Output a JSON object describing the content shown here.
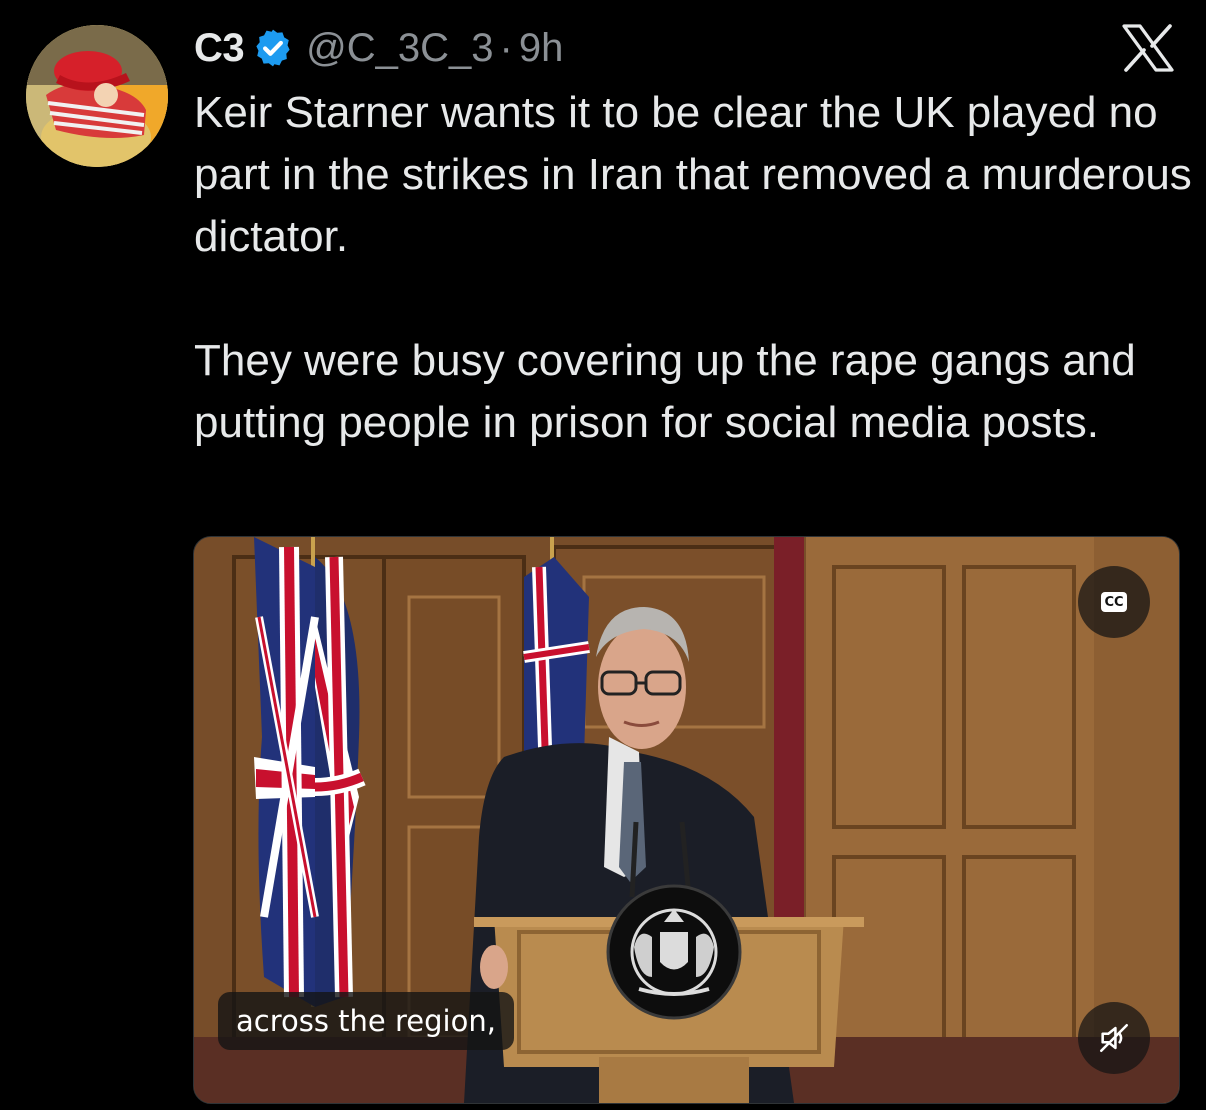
{
  "author": {
    "display_name": "C3",
    "handle": "@C_3C_3",
    "separator": "·",
    "time": "9h",
    "verified": true,
    "avatar_icon": "avatar-red-cap-icon"
  },
  "platform_logo": "x-logo-icon",
  "tweet": {
    "paragraph_1": "Keir Starner wants it to be clear the UK played no part in the strikes in Iran that removed a murderous dictator.",
    "paragraph_2": "They were busy covering up the rape gangs and putting people in prison for social media posts."
  },
  "video": {
    "cc_label": "CC",
    "caption": "across the region,",
    "mute_icon": "muted-speaker-icon"
  },
  "colors": {
    "background": "#000000",
    "text_primary": "#e7e9ea",
    "text_secondary": "#8b9095",
    "verified_blue": "#1d9bf0"
  }
}
